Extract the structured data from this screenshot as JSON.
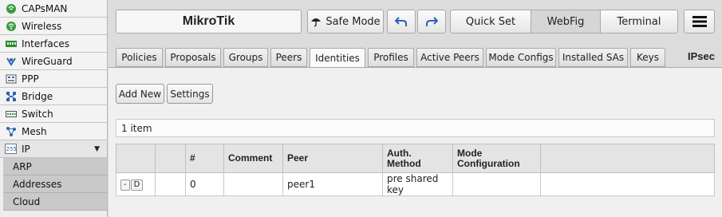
{
  "sidebar": {
    "items": [
      {
        "label": "CAPsMAN",
        "icon": "capsman-icon"
      },
      {
        "label": "Wireless",
        "icon": "wireless-icon"
      },
      {
        "label": "Interfaces",
        "icon": "interfaces-icon"
      },
      {
        "label": "WireGuard",
        "icon": "wireguard-icon"
      },
      {
        "label": "PPP",
        "icon": "ppp-icon"
      },
      {
        "label": "Bridge",
        "icon": "bridge-icon"
      },
      {
        "label": "Switch",
        "icon": "switch-icon"
      },
      {
        "label": "Mesh",
        "icon": "mesh-icon"
      },
      {
        "label": "IP",
        "icon": "ip-icon",
        "expanded": true
      }
    ],
    "subitems": [
      {
        "label": "ARP"
      },
      {
        "label": "Addresses"
      },
      {
        "label": "Cloud"
      }
    ]
  },
  "header": {
    "title": "MikroTik",
    "safe_mode": "Safe Mode",
    "quick_set": "Quick Set",
    "webfig": "WebFig",
    "terminal": "Terminal"
  },
  "tabs": [
    {
      "label": "Policies"
    },
    {
      "label": "Proposals"
    },
    {
      "label": "Groups"
    },
    {
      "label": "Peers"
    },
    {
      "label": "Identities",
      "active": true
    },
    {
      "label": "Profiles"
    },
    {
      "label": "Active Peers"
    },
    {
      "label": "Mode Configs"
    },
    {
      "label": "Installed SAs"
    },
    {
      "label": "Keys"
    }
  ],
  "section_label": "IPsec",
  "actions": {
    "add_new": "Add New",
    "settings": "Settings"
  },
  "count_text": "1 item",
  "table": {
    "headers": [
      "",
      "",
      "#",
      "Comment",
      "Peer",
      "Auth.\nMethod",
      "Mode\nConfiguration",
      ""
    ],
    "header_auth_1": "Auth.",
    "header_auth_2": "Method",
    "header_mode_1": "Mode",
    "header_mode_2": "Configuration",
    "rows": [
      {
        "btn_remove": "-",
        "btn_disable": "D",
        "num": "0",
        "comment": "",
        "peer": "peer1",
        "auth_method": "pre shared key",
        "mode_config": ""
      }
    ]
  },
  "colors": {
    "background": "#dcdcdc",
    "panel": "#f0f0f0",
    "blue_icon": "#2a64b4"
  }
}
